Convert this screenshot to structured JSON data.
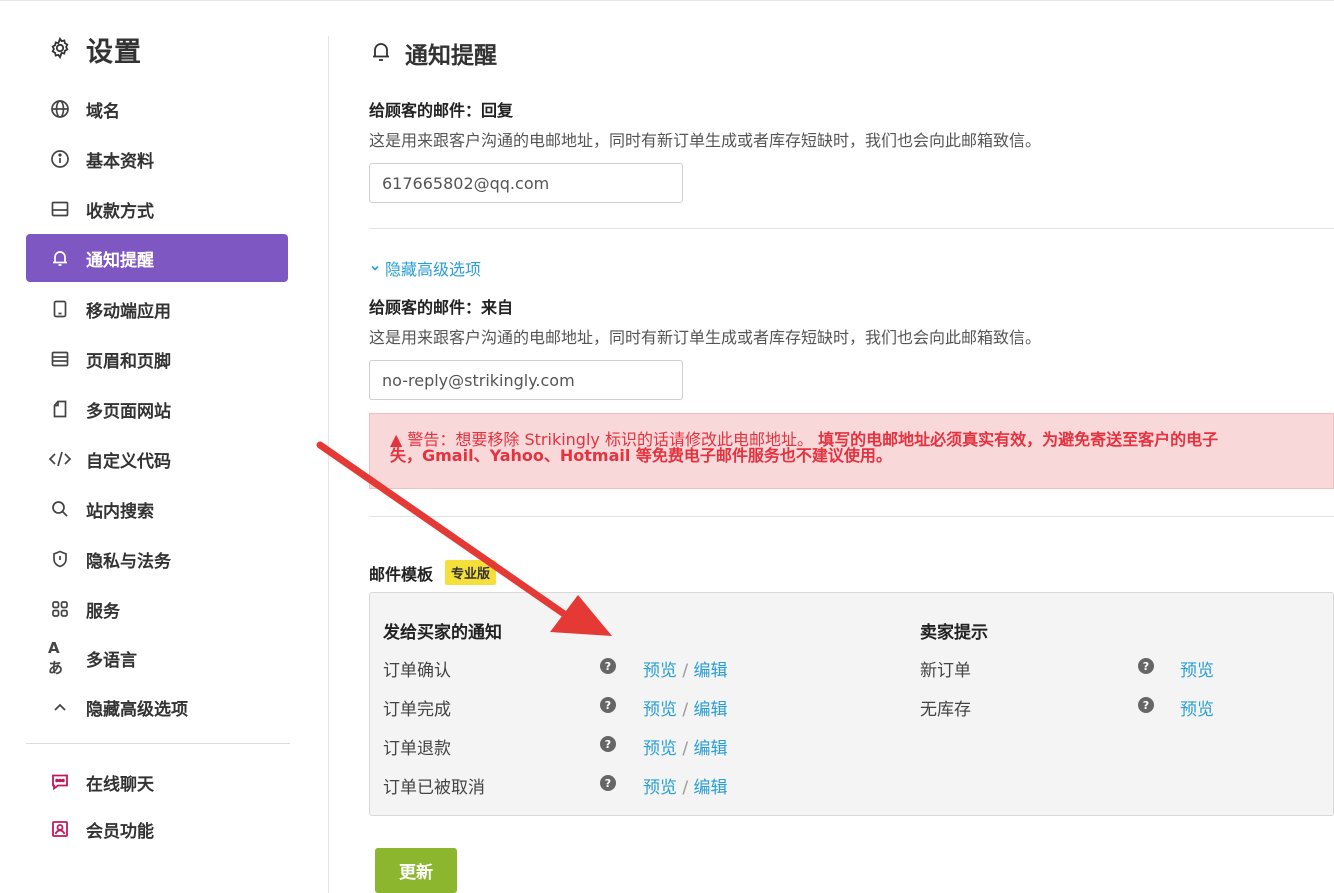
{
  "sidebar": {
    "title": "设置",
    "items": [
      {
        "label": "域名",
        "icon": "globe-icon"
      },
      {
        "label": "基本资料",
        "icon": "info-icon"
      },
      {
        "label": "收款方式",
        "icon": "wallet-icon"
      },
      {
        "label": "通知提醒",
        "icon": "bell-icon",
        "active": true
      },
      {
        "label": "移动端应用",
        "icon": "mobile-icon"
      },
      {
        "label": "页眉和页脚",
        "icon": "layout-icon"
      },
      {
        "label": "多页面网站",
        "icon": "pages-icon"
      },
      {
        "label": "自定义代码",
        "icon": "code-icon"
      },
      {
        "label": "站内搜索",
        "icon": "search-icon"
      },
      {
        "label": "隐私与法务",
        "icon": "shield-icon"
      },
      {
        "label": "服务",
        "icon": "grid-icon"
      },
      {
        "label": "多语言",
        "icon": "language-icon"
      },
      {
        "label": "隐藏高级选项",
        "icon": "chevron-up-icon"
      }
    ],
    "extra_items": [
      {
        "label": "在线聊天",
        "icon": "chat-icon"
      },
      {
        "label": "会员功能",
        "icon": "member-icon"
      }
    ]
  },
  "main": {
    "title": "通知提醒",
    "reply_label": "给顾客的邮件：回复",
    "reply_desc": "这是用来跟客户沟通的电邮地址，同时有新订单生成或者库存短缺时，我们也会向此邮箱致信。",
    "reply_value": "617665802@qq.com",
    "advanced_toggle": "隐藏高级选项",
    "from_label": "给顾客的邮件：来自",
    "from_desc": "这是用来跟客户沟通的电邮地址，同时有新订单生成或者库存短缺时，我们也会向此邮箱致信。",
    "from_value": "no-reply@strikingly.com",
    "warning_prefix": "警告：想要移除 Strikingly 标识的话请修改此电邮地址。",
    "warning_strong_1": "填写的电邮地址必须真实有效，为避免寄送至客户的电子",
    "warning_strong_2": "失，Gmail、Yahoo、Hotmail 等免费电子邮件服务也不建议使用。",
    "templates_label": "邮件模板",
    "pro_badge": "专业版",
    "buyer_head": "发给买家的通知",
    "seller_head": "卖家提示",
    "preview": "预览",
    "edit": "编辑",
    "sep": "/",
    "buyer_rows": [
      "订单确认",
      "订单完成",
      "订单退款",
      "订单已被取消"
    ],
    "seller_rows": [
      "新订单",
      "无库存"
    ],
    "update_button": "更新"
  },
  "colors": {
    "accent": "#7e57c2",
    "link": "#2a9fd6",
    "warning_bg": "#f9d8da",
    "warning_text": "#e5323f",
    "button": "#8bb62d",
    "arrow": "#e53935"
  }
}
